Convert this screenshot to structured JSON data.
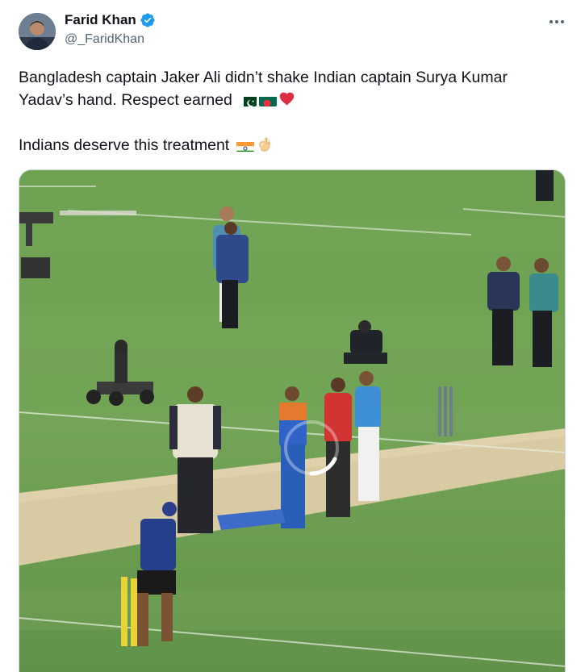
{
  "author": {
    "display_name": "Farid Khan",
    "handle": "@_FaridKhan",
    "verified_icon": "verified-badge-icon",
    "avatar_icon": "avatar"
  },
  "more_icon": "more-options-icon",
  "tweet": {
    "line1": "Bangladesh captain Jaker Ali didn’t shake Indian captain Surya Kumar",
    "line2": "Yadav’s hand. Respect earned",
    "line2_emojis": [
      "pakistan-flag-icon",
      "bangladesh-flag-icon",
      "red-heart-icon"
    ],
    "line3": "Indians deserve this treatment",
    "line3_emojis": [
      "india-flag-icon",
      "ok-hand-icon"
    ]
  },
  "media": {
    "kind": "video-still",
    "content_icon": "cricket-field-photo"
  },
  "colors": {
    "text": "#0f1419",
    "secondary": "#536471",
    "verified": "#1d9bf0",
    "border": "#cfd9de"
  }
}
